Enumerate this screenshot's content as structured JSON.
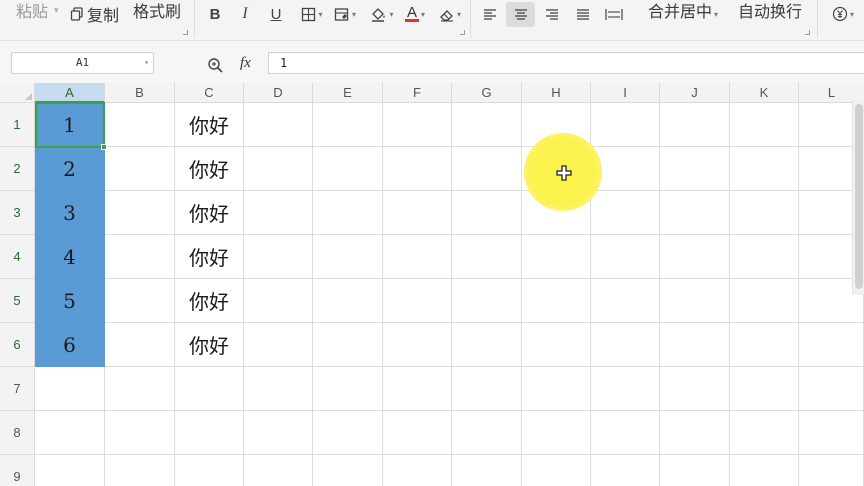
{
  "toolbar": {
    "paste_label": "粘贴",
    "copy_label": "复制",
    "format_painter_label": "格式刷",
    "bold_label": "B",
    "italic_label": "I",
    "underline_label": "U",
    "font_color_label": "A",
    "merge_center_label": "合并居中",
    "wrap_text_label": "自动换行",
    "font_color": "#e03030"
  },
  "formula_bar": {
    "name_box": "A1",
    "fx_label": "fx",
    "formula_value": "1"
  },
  "sheet": {
    "columns": [
      "A",
      "B",
      "C",
      "D",
      "E",
      "F",
      "G",
      "H",
      "I",
      "J",
      "K",
      "L"
    ],
    "rows": [
      "1",
      "2",
      "3",
      "4",
      "5",
      "6",
      "7",
      "8",
      "9"
    ],
    "column_a_values": [
      "1",
      "2",
      "3",
      "4",
      "5",
      "6"
    ],
    "column_c_values": [
      "你好",
      "你好",
      "你好",
      "你好",
      "你好",
      "你好"
    ],
    "selection_color": "#5b9bd5",
    "active_cell_border": "#3aa04a"
  },
  "cursor": {
    "highlight_color": "#fbf24a",
    "icon": "cross-move-cursor-icon"
  }
}
